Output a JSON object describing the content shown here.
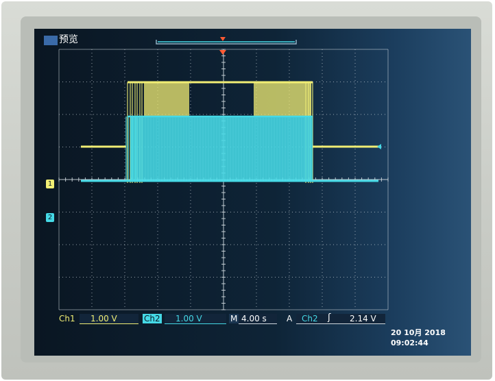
{
  "header": {
    "mode_label": "预览"
  },
  "markers": {
    "ch1_ground": "1",
    "ch2_ground": "2"
  },
  "status_bar": {
    "ch1_label": "Ch1",
    "ch1_scale": "1.00 V",
    "ch2_label": "Ch2",
    "ch2_scale": "1.00 V",
    "timebase_label": "M",
    "timebase_value": "4.00 s",
    "trigger_mode_label": "A",
    "trigger_source": "Ch2",
    "trigger_slope_symbol": "ʃ",
    "trigger_level": "2.14 V"
  },
  "datetime": {
    "date": "20 10月 2018",
    "time": "09:02:44"
  },
  "colors": {
    "ch1": "#f1ee74",
    "ch2": "#45d9e6",
    "grid": "#cfd8de",
    "trigger": "#ff5a33"
  },
  "icons": {
    "slope": "rising-edge-icon",
    "trigger_marker": "triangle-down-icon"
  }
}
